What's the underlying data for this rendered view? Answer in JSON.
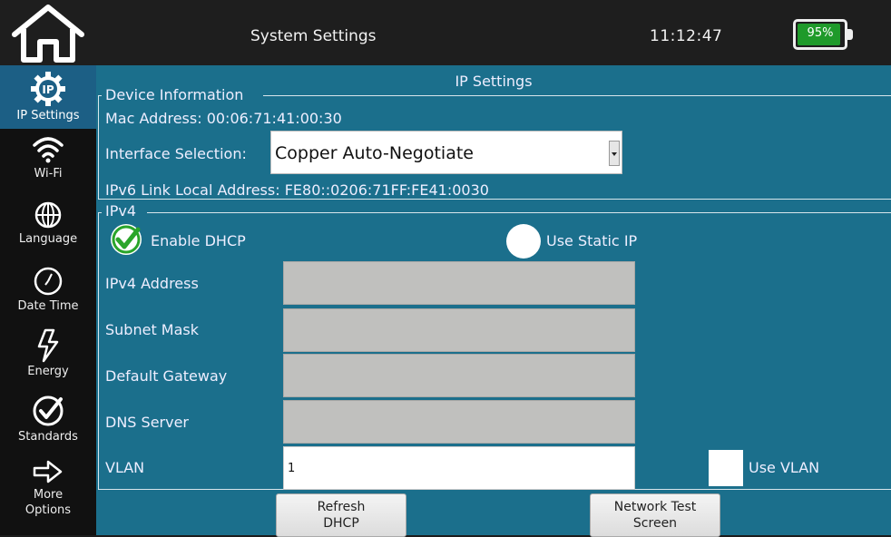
{
  "header": {
    "title": "System Settings",
    "time": "11:12:47",
    "battery_text": "95%",
    "battery_level": 0.95,
    "battery_color": "#1f9a2a",
    "home_icon": "home-icon"
  },
  "sidebar": {
    "items": [
      {
        "label": "IP Settings",
        "icon": "ip-gear-icon",
        "active": true
      },
      {
        "label": "Wi-Fi",
        "icon": "wifi-icon"
      },
      {
        "label": "Language",
        "icon": "globe-icon"
      },
      {
        "label": "Date Time",
        "icon": "clock-icon"
      },
      {
        "label": "Energy",
        "icon": "lightning-icon"
      },
      {
        "label": "Standards",
        "icon": "check-circle-icon"
      },
      {
        "label": "More Options",
        "label_line1": "More",
        "label_line2": "Options",
        "icon": "arrow-right-icon"
      }
    ]
  },
  "main": {
    "title": "IP Settings",
    "device_info": {
      "legend": "Device Information",
      "mac": "Mac Address: 00:06:71:41:00:30",
      "interface_label": "Interface Selection:",
      "interface_value": "Copper Auto-Negotiate",
      "ipv6": "IPv6 Link Local Address: FE80::0206:71FF:FE41:0030"
    },
    "ipv4": {
      "legend": "IPv4",
      "enable_dhcp": "Enable DHCP",
      "use_static_ip": "Use Static IP",
      "address_label": "IPv4 Address",
      "subnet_label": "Subnet Mask",
      "gateway_label": "Default Gateway",
      "dns_label": "DNS Server",
      "vlan_label": "VLAN",
      "vlan_value": "1",
      "use_vlan": "Use VLAN"
    },
    "buttons": {
      "refresh_line1": "Refresh",
      "refresh_line2": "DHCP",
      "network_line1": "Network Test",
      "network_line2": "Screen"
    }
  },
  "colors": {
    "panel": "#1b6f8c",
    "sidebar_active": "#1c5f85",
    "check_green": "#2aa52a"
  }
}
